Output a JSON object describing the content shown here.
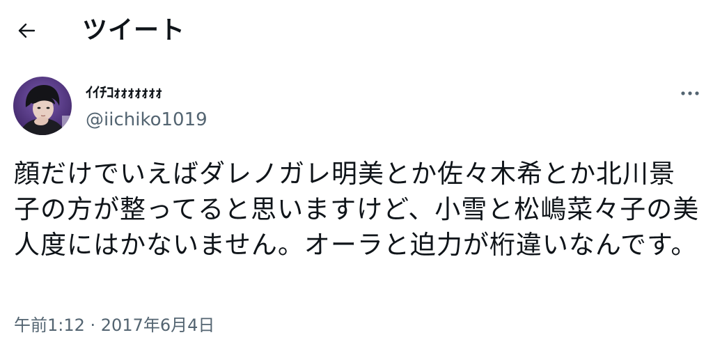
{
  "header": {
    "title": "ツイート",
    "back_icon": "arrow-left-icon"
  },
  "tweet": {
    "author": {
      "display_name": "ｲｲﾁｺｫｫｫｫｫｫｫ",
      "handle": "@iichiko1019"
    },
    "more_icon": "more-horizontal-icon",
    "text": "顔だけでいえばダレノガレ明美とか佐々木希とか北川景子の方が整ってると思いますけど、小雪と松嶋菜々子の美人度にはかないません。オーラと迫力が桁違いなんです。",
    "timestamp": "午前1:12 · 2017年6月4日"
  },
  "colors": {
    "text_primary": "#0f1419",
    "text_secondary": "#536471",
    "background": "#ffffff"
  }
}
